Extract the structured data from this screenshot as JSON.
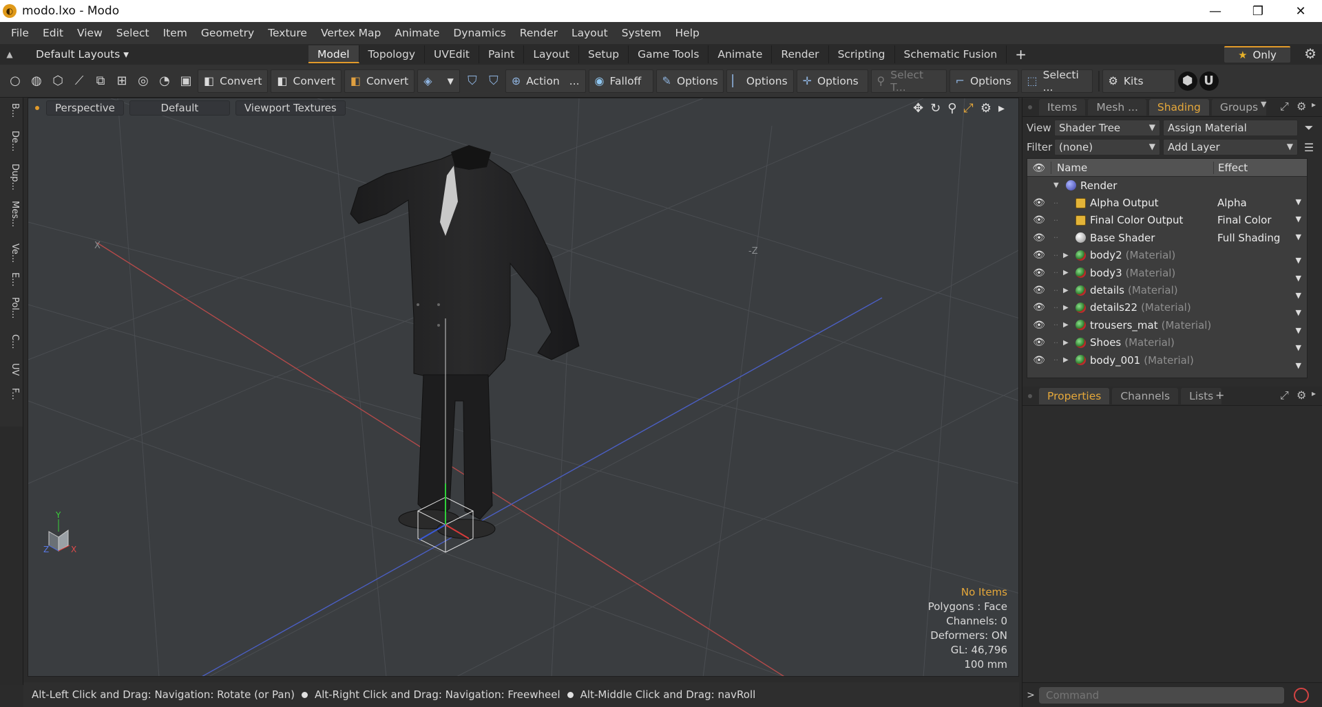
{
  "window": {
    "title": "modo.lxo - Modo",
    "app_icon_glyph": "◐",
    "controls": [
      "—",
      "❐",
      "✕"
    ]
  },
  "menu": [
    "File",
    "Edit",
    "View",
    "Select",
    "Item",
    "Geometry",
    "Texture",
    "Vertex Map",
    "Animate",
    "Dynamics",
    "Render",
    "Layout",
    "System",
    "Help"
  ],
  "layouts": {
    "selector": "Default Layouts ▾",
    "tabs": [
      "Model",
      "Topology",
      "UVEdit",
      "Paint",
      "Layout",
      "Setup",
      "Game Tools",
      "Animate",
      "Render",
      "Scripting",
      "Schematic Fusion"
    ],
    "active_tab": "Model",
    "plus": "+",
    "only_label": "Only",
    "accent": "#e39b2a"
  },
  "toolbar": {
    "convert1": "Convert",
    "convert2": "Convert",
    "convert3": "Convert",
    "action": "Action",
    "action_more": "...",
    "falloff": "Falloff",
    "options1": "Options",
    "options2": "Options",
    "options3": "Options",
    "select_t": "Select T...",
    "options4": "Options",
    "selecti": "Selecti ...",
    "kits": "Kits"
  },
  "left_tabs": [
    "B...",
    "De...",
    "Dup...",
    "Mes...",
    "Ve...",
    "E...",
    "Pol...",
    "C...",
    "UV",
    "F..."
  ],
  "viewport": {
    "view_mode": "Perspective",
    "shading": "Default",
    "textures": "Viewport Textures",
    "axis_x": "X",
    "axis_z": "-Z",
    "gizmo_y": "Y",
    "gizmo_z": "Z",
    "gizmo_x": "X",
    "info": {
      "no_items": "No Items",
      "polygons": "Polygons : Face",
      "channels": "Channels: 0",
      "deformers": "Deformers: ON",
      "gl": "GL: 46,796",
      "scale": "100 mm"
    }
  },
  "status": {
    "hint1": "Alt-Left Click and Drag: Navigation: Rotate (or Pan)",
    "hint2": "Alt-Right Click and Drag: Navigation: Freewheel",
    "hint3": "Alt-Middle Click and Drag: navRoll"
  },
  "right_panel": {
    "tabs": [
      "Items",
      "Mesh ...",
      "Shading",
      "Groups"
    ],
    "active_tab": "Shading",
    "view_label": "View",
    "view_value": "Shader Tree",
    "assign_material": "Assign Material",
    "filter_label": "Filter",
    "filter_value": "(none)",
    "add_layer": "Add Layer",
    "tree_header_name": "Name",
    "tree_header_effect": "Effect",
    "material_tag": "(Material)",
    "tree": [
      {
        "name": "Render",
        "type": "render",
        "effect": "",
        "level": 0,
        "expand": "▼",
        "eye": false
      },
      {
        "name": "Alpha Output",
        "type": "out",
        "effect": "Alpha",
        "level": 1,
        "expand": "",
        "eye": true
      },
      {
        "name": "Final Color Output",
        "type": "out",
        "effect": "Final Color",
        "level": 1,
        "expand": "",
        "eye": true
      },
      {
        "name": "Base Shader",
        "type": "shader",
        "effect": "Full Shading",
        "level": 1,
        "expand": "",
        "eye": true
      },
      {
        "name": "body2",
        "type": "mat",
        "effect": "",
        "level": 1,
        "expand": "▶",
        "eye": true
      },
      {
        "name": "body3",
        "type": "mat",
        "effect": "",
        "level": 1,
        "expand": "▶",
        "eye": true
      },
      {
        "name": "details",
        "type": "mat",
        "effect": "",
        "level": 1,
        "expand": "▶",
        "eye": true
      },
      {
        "name": "details22",
        "type": "mat",
        "effect": "",
        "level": 1,
        "expand": "▶",
        "eye": true
      },
      {
        "name": "trousers_mat",
        "type": "mat",
        "effect": "",
        "level": 1,
        "expand": "▶",
        "eye": true
      },
      {
        "name": "Shoes",
        "type": "mat",
        "effect": "",
        "level": 1,
        "expand": "▶",
        "eye": true
      },
      {
        "name": "body_001",
        "type": "mat",
        "effect": "",
        "level": 1,
        "expand": "▶",
        "eye": true
      }
    ],
    "lower_tabs": [
      "Properties",
      "Channels",
      "Lists"
    ],
    "lower_active": "Properties",
    "command_placeholder": "Command"
  }
}
